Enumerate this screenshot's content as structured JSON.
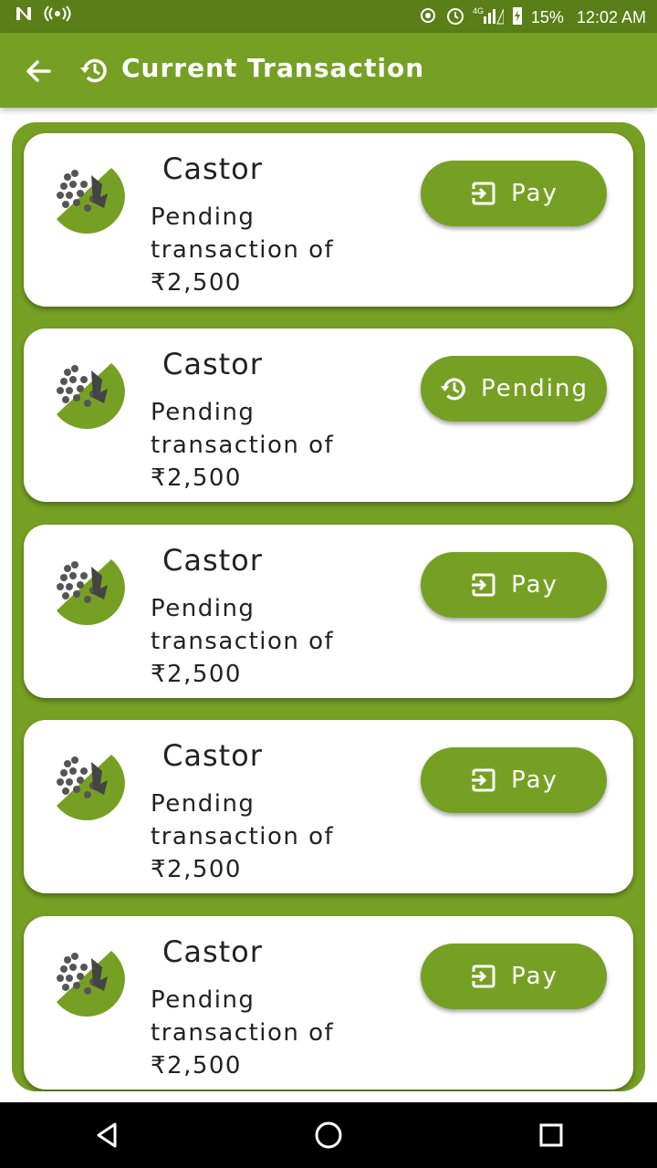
{
  "status_bar": {
    "battery": "15%",
    "time": "12:02 AM",
    "network": "4G"
  },
  "app_bar": {
    "title": "Current Transaction",
    "back_icon": "arrow-back-icon",
    "title_icon": "history-icon"
  },
  "transactions": [
    {
      "name": "Castor",
      "description": "Pending transaction of ₹2,500",
      "action": "Pay",
      "action_icon": "exit-to-app-icon"
    },
    {
      "name": "Castor",
      "description": "Pending transaction of ₹2,500",
      "action": "Pending",
      "action_icon": "history-icon"
    },
    {
      "name": "Castor",
      "description": "Pending transaction of ₹2,500",
      "action": "Pay",
      "action_icon": "exit-to-app-icon"
    },
    {
      "name": "Castor",
      "description": "Pending transaction of ₹2,500",
      "action": "Pay",
      "action_icon": "exit-to-app-icon"
    },
    {
      "name": "Castor",
      "description": "Pending transaction of ₹2,500",
      "action": "Pay",
      "action_icon": "exit-to-app-icon"
    }
  ],
  "colors": {
    "primary": "#76a024",
    "status_bar": "#5b7f18",
    "card": "#ffffff",
    "nav_bar": "#000000"
  }
}
